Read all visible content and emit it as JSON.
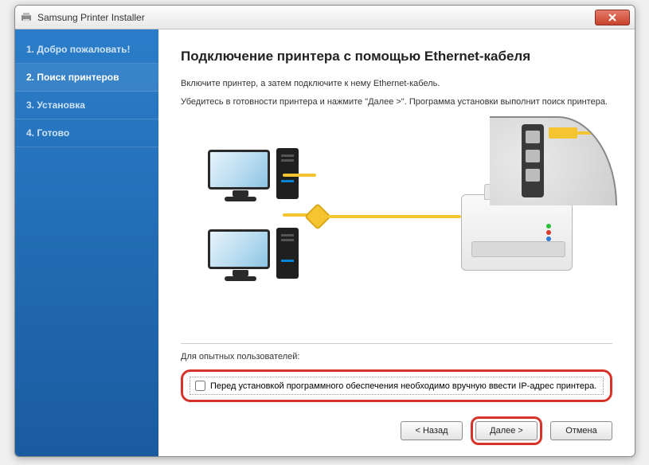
{
  "window": {
    "title": "Samsung Printer Installer"
  },
  "sidebar": {
    "steps": [
      {
        "label": "1. Добро пожаловать!"
      },
      {
        "label": "2. Поиск принтеров"
      },
      {
        "label": "3. Установка"
      },
      {
        "label": "4. Готово"
      }
    ],
    "activeIndex": 1
  },
  "main": {
    "heading": "Подключение принтера с помощью Ethernet-кабеля",
    "desc1": "Включите принтер, а затем подключите к нему Ethernet-кабель.",
    "desc2": "Убедитесь в готовности принтера и нажмите \"Далее >\". Программа установки выполнит поиск принтера."
  },
  "advanced": {
    "sectionLabel": "Для опытных пользователей:",
    "checkboxLabel": "Перед установкой программного обеспечения необходимо вручную ввести IP-адрес принтера.",
    "checked": false
  },
  "buttons": {
    "back": "< Назад",
    "next": "Далее >",
    "cancel": "Отмена"
  }
}
